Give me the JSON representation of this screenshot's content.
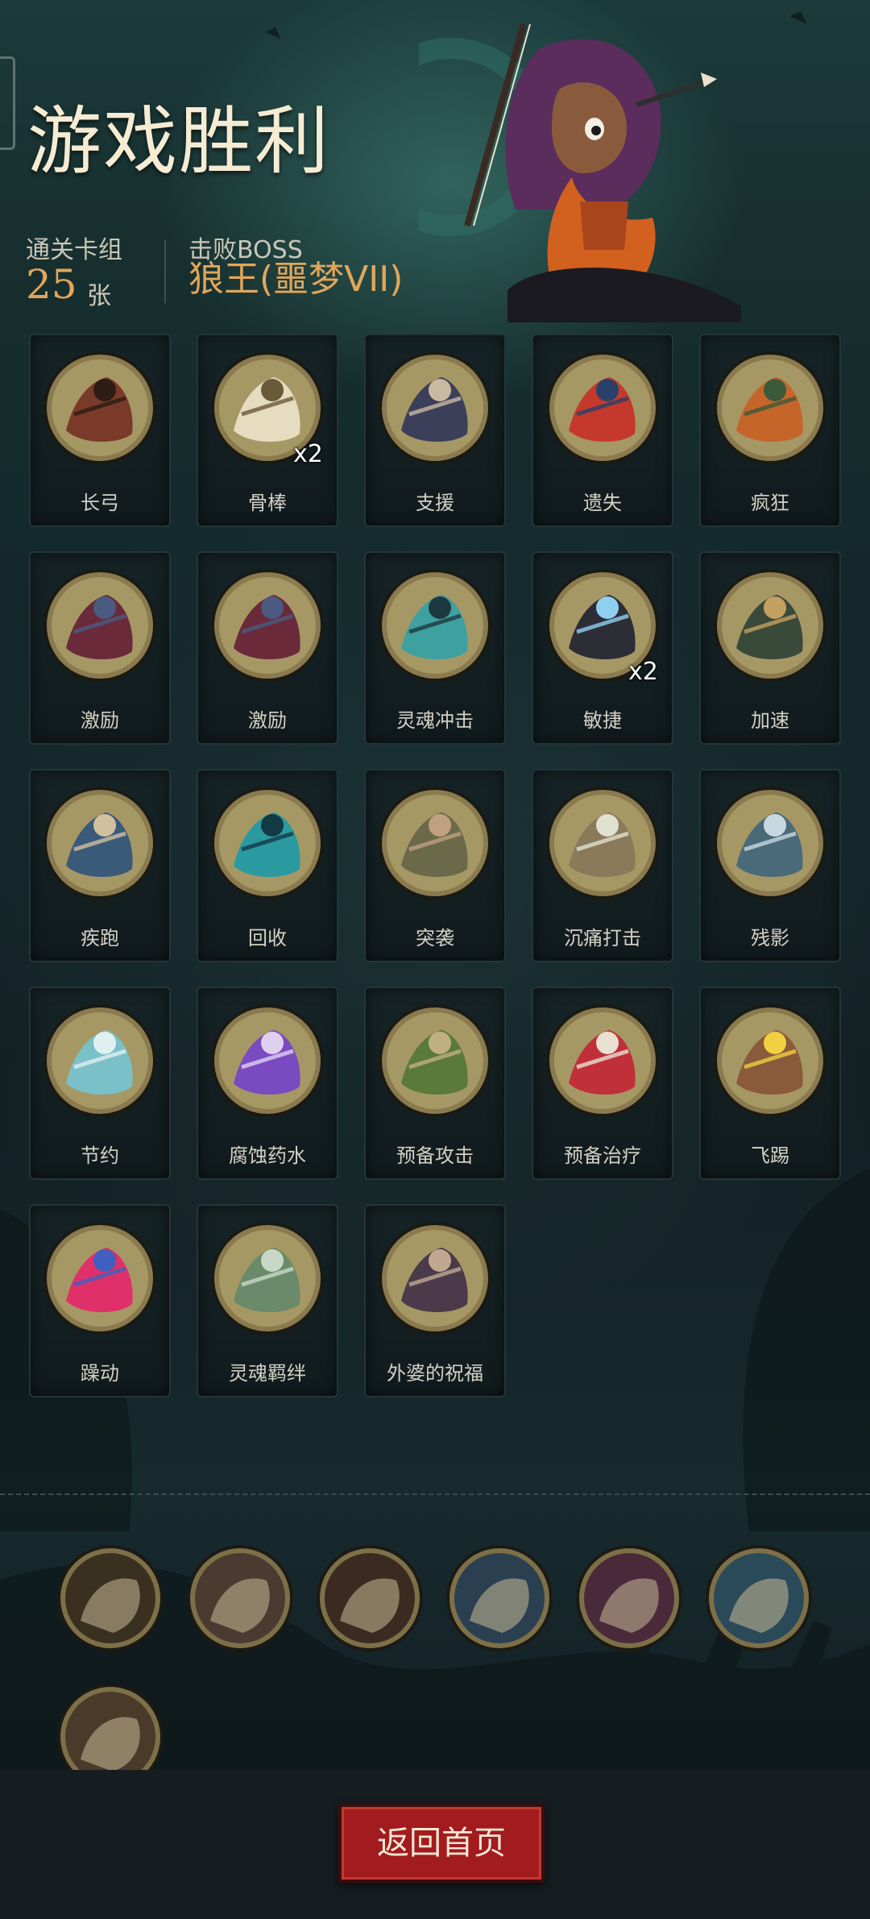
{
  "header": {
    "title": "游戏胜利",
    "cards_label": "通关卡组",
    "cards_count": "25",
    "cards_unit": "张",
    "boss_label": "击败BOSS",
    "boss_name": "狼王(噩梦VII)"
  },
  "cards": [
    {
      "label": "长弓",
      "icon": "longbow-icon",
      "mult": ""
    },
    {
      "label": "骨棒",
      "icon": "bone-club-icon",
      "mult": "x2"
    },
    {
      "label": "支援",
      "icon": "support-icon",
      "mult": ""
    },
    {
      "label": "遗失",
      "icon": "lost-icon",
      "mult": ""
    },
    {
      "label": "疯狂",
      "icon": "madness-icon",
      "mult": ""
    },
    {
      "label": "激励",
      "icon": "inspire-icon",
      "mult": ""
    },
    {
      "label": "激励",
      "icon": "inspire-icon",
      "mult": ""
    },
    {
      "label": "灵魂冲击",
      "icon": "soul-strike-icon",
      "mult": ""
    },
    {
      "label": "敏捷",
      "icon": "agility-icon",
      "mult": "x2"
    },
    {
      "label": "加速",
      "icon": "haste-icon",
      "mult": ""
    },
    {
      "label": "疾跑",
      "icon": "sprint-icon",
      "mult": ""
    },
    {
      "label": "回收",
      "icon": "recycle-icon",
      "mult": ""
    },
    {
      "label": "突袭",
      "icon": "raid-icon",
      "mult": ""
    },
    {
      "label": "沉痛打击",
      "icon": "heavy-blow-icon",
      "mult": ""
    },
    {
      "label": "残影",
      "icon": "afterimage-icon",
      "mult": ""
    },
    {
      "label": "节约",
      "icon": "thrift-icon",
      "mult": ""
    },
    {
      "label": "腐蚀药水",
      "icon": "corrosive-potion-icon",
      "mult": ""
    },
    {
      "label": "预备攻击",
      "icon": "ready-attack-icon",
      "mult": ""
    },
    {
      "label": "预备治疗",
      "icon": "ready-heal-icon",
      "mult": ""
    },
    {
      "label": "飞踢",
      "icon": "flying-kick-icon",
      "mult": ""
    },
    {
      "label": "躁动",
      "icon": "restless-icon",
      "mult": ""
    },
    {
      "label": "灵魂羁绊",
      "icon": "soul-bond-icon",
      "mult": ""
    },
    {
      "label": "外婆的祝福",
      "icon": "grandma-blessing-icon",
      "mult": ""
    }
  ],
  "relics": [
    {
      "icon": "skull-card-relic-icon"
    },
    {
      "icon": "warrior-slash-relic-icon"
    },
    {
      "icon": "blade-strike-relic-icon"
    },
    {
      "icon": "goblin-relic-icon"
    },
    {
      "icon": "vampire-relic-icon"
    },
    {
      "icon": "card-hand-relic-icon"
    },
    {
      "icon": "barbarian-relic-icon"
    }
  ],
  "footer": {
    "home_button": "返回首页"
  },
  "colors": {
    "accent_gold": "#e2a65a",
    "button_red": "#a21b1e",
    "medal_rim": "#8a7a4e"
  }
}
